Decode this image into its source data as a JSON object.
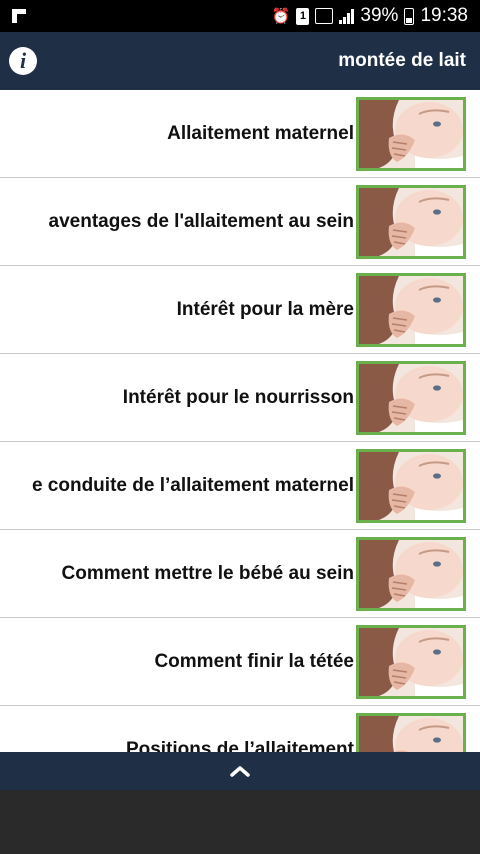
{
  "status_bar": {
    "battery_percent": "39%",
    "time": "19:38",
    "sim_slot": "1",
    "icons": [
      "notification-flag-icon",
      "alarm-icon",
      "sim-icon",
      "signal-icon",
      "battery-icon"
    ]
  },
  "header": {
    "info_icon": "info-icon",
    "title": "montée de lait"
  },
  "list": {
    "items": [
      {
        "label": "Allaitement maternel",
        "thumbnail": "baby-nursing-thumbnail"
      },
      {
        "label": "aventages de l'allaitement au sein",
        "thumbnail": "baby-nursing-thumbnail"
      },
      {
        "label": "Intérêt  pour la mère",
        "thumbnail": "baby-nursing-thumbnail"
      },
      {
        "label": "Intérêt pour le nourrisson",
        "thumbnail": "baby-nursing-thumbnail"
      },
      {
        "label": "e conduite de l’allaitement maternel",
        "thumbnail": "baby-nursing-thumbnail"
      },
      {
        "label": "Comment mettre le bébé au sein",
        "thumbnail": "baby-nursing-thumbnail"
      },
      {
        "label": "Comment finir la tétée",
        "thumbnail": "baby-nursing-thumbnail"
      },
      {
        "label": "Positions de l’allaitement",
        "thumbnail": "baby-nursing-thumbnail"
      }
    ]
  },
  "bottom_bar": {
    "icon": "chevron-up-icon"
  },
  "colors": {
    "header": "#1f2f46",
    "thumb_border": "#6ab04c",
    "status_bar": "#000000"
  }
}
